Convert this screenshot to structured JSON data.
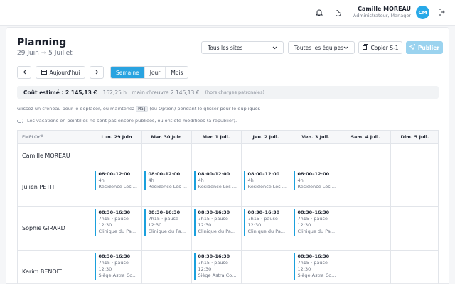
{
  "header": {
    "user_name": "Camille MOREAU",
    "user_role": "Administrateur, Manager",
    "avatar_initials": "CM"
  },
  "page": {
    "title": "Planning",
    "date_range": "29 Juin → 5 Juillet"
  },
  "filters": {
    "site": "Tous les sites",
    "team": "Toutes les équipes"
  },
  "actions": {
    "copy": "Copier S-1",
    "publish": "Publier",
    "today": "Aujourd'hui"
  },
  "views": [
    {
      "label": "Semaine",
      "active": true
    },
    {
      "label": "Jour",
      "active": false
    },
    {
      "label": "Mois",
      "active": false
    }
  ],
  "cost": {
    "label": "Coût estimé : 2 145,13 €",
    "detail": "162,25 h · main d'œuvre 2 145,13 €",
    "note": "(hors charges patronales)"
  },
  "hint": {
    "before": "Glissez un créneau pour le déplacer, ou maintenez",
    "key": "Maj",
    "after": "(ou Option) pendant le glisser pour le dupliquer."
  },
  "legend_note": "Les vacations en pointillés ne sont pas encore publiées, ou ont été modifiées (à republier).",
  "table": {
    "employee_header": "EMPLOYÉ",
    "days": [
      "Lun. 29 Juin",
      "Mar. 30 Juin",
      "Mer. 1 Juil.",
      "Jeu. 2 Juil.",
      "Ven. 3 Juil.",
      "Sam. 4 Juil.",
      "Dim. 5 Juil."
    ],
    "rows": [
      {
        "name": "Camille MOREAU",
        "shifts": [
          null,
          null,
          null,
          null,
          null,
          null,
          null
        ]
      },
      {
        "name": "Julien PETIT",
        "shifts": [
          {
            "time": "08:00–12:00",
            "duration": "4h",
            "place": "Résidence Les ..."
          },
          {
            "time": "08:00–12:00",
            "duration": "4h",
            "place": "Résidence Les ..."
          },
          {
            "time": "08:00–12:00",
            "duration": "4h",
            "place": "Résidence Les ..."
          },
          {
            "time": "08:00–12:00",
            "duration": "4h",
            "place": "Résidence Les ..."
          },
          {
            "time": "08:00–12:00",
            "duration": "4h",
            "place": "Résidence Les ..."
          },
          null,
          null
        ]
      },
      {
        "name": "Sophie GIRARD",
        "shifts": [
          {
            "time": "08:30–16:30",
            "duration": "7h15 · pause",
            "pause": "12:30",
            "place": "Clinique du Pa..."
          },
          {
            "time": "08:30–16:30",
            "duration": "7h15 · pause",
            "pause": "12:30",
            "place": "Clinique du Pa..."
          },
          {
            "time": "08:30–16:30",
            "duration": "7h15 · pause",
            "pause": "12:30",
            "place": "Clinique du Pa..."
          },
          {
            "time": "08:30–16:30",
            "duration": "7h15 · pause",
            "pause": "12:30",
            "place": "Clinique du Pa..."
          },
          {
            "time": "08:30–16:30",
            "duration": "7h15 · pause",
            "pause": "12:30",
            "place": "Clinique du Pa..."
          },
          null,
          null
        ]
      },
      {
        "name": "Karim BENOIT",
        "shifts": [
          {
            "time": "08:30–16:30",
            "duration": "7h15 · pause",
            "pause": "12:30",
            "place": "Siège Astra Co..."
          },
          null,
          {
            "time": "08:30–16:30",
            "duration": "7h15 · pause",
            "pause": "12:30",
            "place": "Siège Astra Co..."
          },
          null,
          {
            "time": "08:30–16:30",
            "duration": "7h15 · pause",
            "pause": "12:30",
            "place": "Siège Astra Co..."
          },
          null,
          null
        ]
      }
    ]
  }
}
